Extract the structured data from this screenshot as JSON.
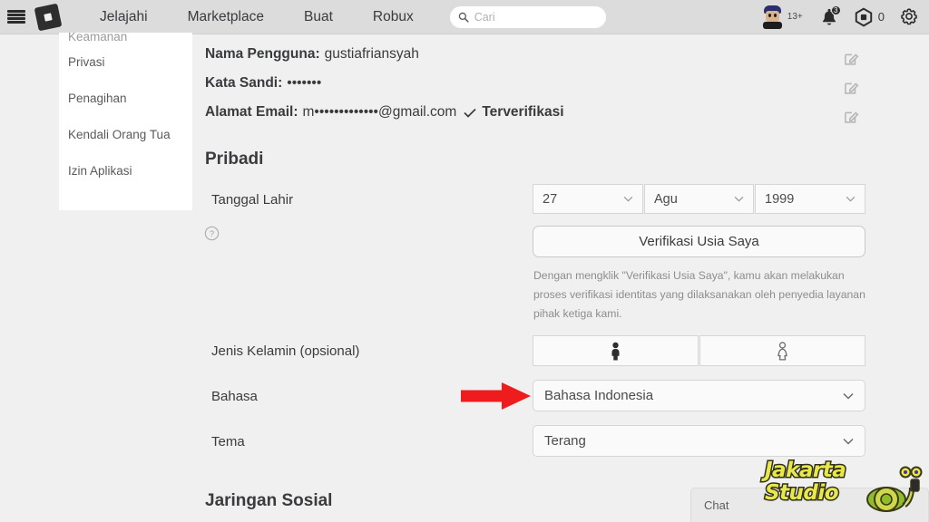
{
  "header": {
    "menu_icon": "hamburger-icon",
    "logo_icon": "roblox-logo-icon",
    "nav": [
      {
        "label": "Jelajahi"
      },
      {
        "label": "Marketplace"
      },
      {
        "label": "Buat"
      },
      {
        "label": "Robux"
      }
    ],
    "search": {
      "icon": "search-icon",
      "placeholder": "Cari",
      "value": ""
    },
    "avatar": {
      "icon": "avatar",
      "age_badge": "13+"
    },
    "notifications": {
      "icon": "bell-icon",
      "count": "3"
    },
    "robux": {
      "icon": "robux-icon",
      "amount": "0"
    },
    "settings": {
      "icon": "gear-icon"
    }
  },
  "sidebar": {
    "items": [
      {
        "label": "Keamanan",
        "cut_off": true
      },
      {
        "label": "Privasi"
      },
      {
        "label": "Penagihan"
      },
      {
        "label": "Kendali Orang Tua"
      },
      {
        "label": "Izin Aplikasi"
      }
    ]
  },
  "account": {
    "rows": [
      {
        "label": "Nama Pengguna:",
        "value": "gustiafriansyah",
        "edit_icon": "edit-pencil-icon"
      },
      {
        "label": "Kata Sandi:",
        "value": "•••••••",
        "edit_icon": "edit-pencil-icon"
      },
      {
        "label": "Alamat Email:",
        "value": "m•••••••••••••@gmail.com",
        "badge": "Terverifikasi",
        "edit_icon": "edit-pencil-icon"
      }
    ]
  },
  "personal": {
    "title": "Pribadi",
    "birthdate": {
      "label": "Tanggal Lahir",
      "help_icon": "help-circle-icon",
      "day": "27",
      "month": "Agu",
      "year": "1999"
    },
    "verify_button": "Verifikasi Usia Saya",
    "verify_note": "Dengan mengklik \"Verifikasi Usia Saya\", kamu akan melakukan proses verifikasi identitas yang dilaksanakan oleh penyedia layanan pihak ketiga kami.",
    "gender": {
      "label": "Jenis Kelamin (opsional)",
      "options": [
        {
          "icon": "male-figure-icon",
          "selected": true
        },
        {
          "icon": "female-figure-icon",
          "selected": false
        }
      ]
    },
    "language": {
      "label": "Bahasa",
      "value": "Bahasa Indonesia"
    },
    "theme": {
      "label": "Tema",
      "value": "Terang"
    }
  },
  "social": {
    "title": "Jaringan Sosial"
  },
  "annotation": {
    "arrow_icon": "red-arrow-right-icon",
    "color": "#ee1c1c"
  },
  "chat": {
    "label": "Chat"
  },
  "watermark": {
    "line1": "Jakarta",
    "line2": "Studio",
    "mascot_icon": "snail-mascot-icon"
  }
}
